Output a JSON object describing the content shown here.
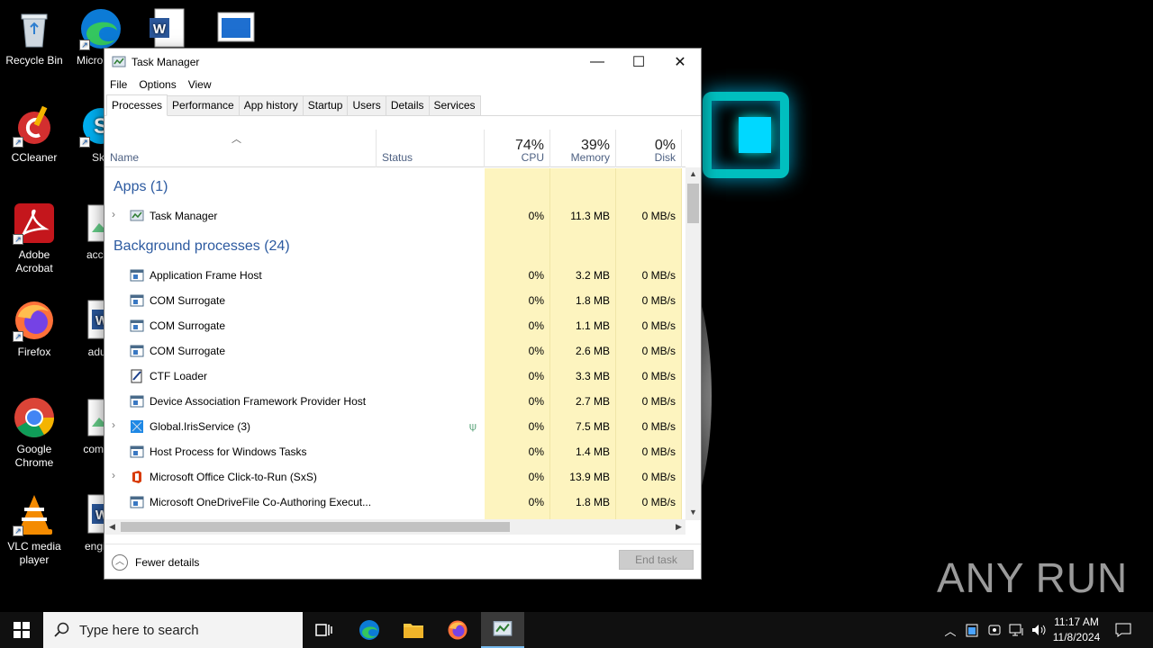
{
  "desktop": {
    "icons": [
      {
        "label": "Recycle Bin"
      },
      {
        "label": "Micro Edg"
      },
      {
        "label": "CCleaner"
      },
      {
        "label": "Sky"
      },
      {
        "label": "Adobe Acrobat"
      },
      {
        "label": "accou"
      },
      {
        "label": "Firefox"
      },
      {
        "label": "adultl"
      },
      {
        "label": "Google Chrome"
      },
      {
        "label": "commu"
      },
      {
        "label": "VLC media player"
      },
      {
        "label": "engine"
      }
    ],
    "watermark": {
      "left": "ANY",
      "right": "RUN"
    }
  },
  "task_manager": {
    "title": "Task Manager",
    "window_controls": {
      "minimize": "—",
      "maximize": "☐",
      "close": "✕"
    },
    "menu": [
      "File",
      "Options",
      "View"
    ],
    "tabs": [
      "Processes",
      "Performance",
      "App history",
      "Startup",
      "Users",
      "Details",
      "Services"
    ],
    "active_tab": "Processes",
    "columns": {
      "name": "Name",
      "status": "Status",
      "cpu": {
        "percent": "74%",
        "label": "CPU"
      },
      "memory": {
        "percent": "39%",
        "label": "Memory"
      },
      "disk": {
        "percent": "0%",
        "label": "Disk"
      }
    },
    "groups": {
      "apps": "Apps (1)",
      "background": "Background processes (24)"
    },
    "app_rows": [
      {
        "name": "Task Manager",
        "cpu": "0%",
        "memory": "11.3 MB",
        "disk": "0 MB/s",
        "expandable": true,
        "icon": "task-manager-icon"
      }
    ],
    "background_rows": [
      {
        "name": "Application Frame Host",
        "cpu": "0%",
        "memory": "3.2 MB",
        "disk": "0 MB/s",
        "icon": "window-process-icon"
      },
      {
        "name": "COM Surrogate",
        "cpu": "0%",
        "memory": "1.8 MB",
        "disk": "0 MB/s",
        "icon": "window-process-icon"
      },
      {
        "name": "COM Surrogate",
        "cpu": "0%",
        "memory": "1.1 MB",
        "disk": "0 MB/s",
        "icon": "window-process-icon"
      },
      {
        "name": "COM Surrogate",
        "cpu": "0%",
        "memory": "2.6 MB",
        "disk": "0 MB/s",
        "icon": "window-process-icon"
      },
      {
        "name": "CTF Loader",
        "cpu": "0%",
        "memory": "3.3 MB",
        "disk": "0 MB/s",
        "icon": "ctf-loader-icon"
      },
      {
        "name": "Device Association Framework Provider Host",
        "cpu": "0%",
        "memory": "2.7 MB",
        "disk": "0 MB/s",
        "icon": "window-process-icon"
      },
      {
        "name": "Global.IrisService (3)",
        "cpu": "0%",
        "memory": "7.5 MB",
        "disk": "0 MB/s",
        "icon": "iris-service-icon",
        "expandable": true,
        "status_icon": "leaf-icon"
      },
      {
        "name": "Host Process for Windows Tasks",
        "cpu": "0%",
        "memory": "1.4 MB",
        "disk": "0 MB/s",
        "icon": "window-process-icon"
      },
      {
        "name": "Microsoft Office Click-to-Run (SxS)",
        "cpu": "0%",
        "memory": "13.9 MB",
        "disk": "0 MB/s",
        "icon": "office-icon",
        "expandable": true
      },
      {
        "name": "Microsoft OneDriveFile Co-Authoring Execut...",
        "cpu": "0%",
        "memory": "1.8 MB",
        "disk": "0 MB/s",
        "icon": "window-process-icon"
      }
    ],
    "footer": {
      "fewer_details": "Fewer details",
      "end_task": "End task"
    }
  },
  "taskbar": {
    "search_placeholder": "Type here to search",
    "clock_time": "11:17 AM",
    "clock_date": "11/8/2024"
  }
}
